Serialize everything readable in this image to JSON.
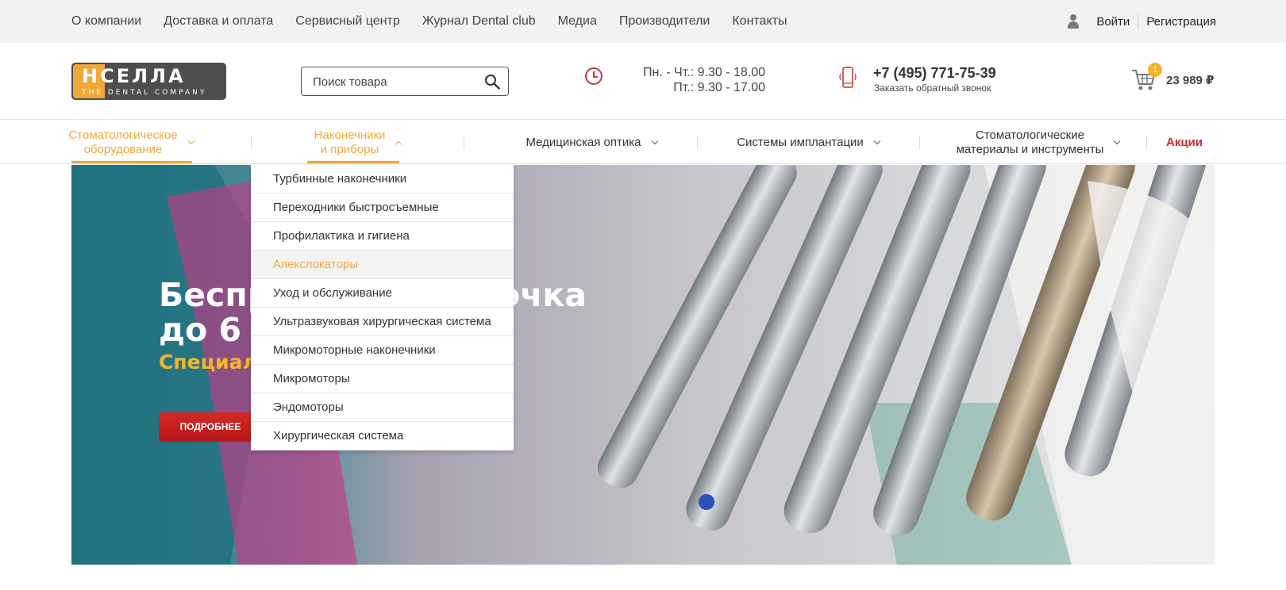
{
  "topnav": {
    "links": [
      "О компании",
      "Доставка и оплата",
      "Сервисный центр",
      "Журнал Dental club",
      "Медиа",
      "Производители",
      "Контакты"
    ]
  },
  "auth": {
    "login": "Войти",
    "register": "Регистрация",
    "user_icon": "user-icon"
  },
  "logo": {
    "big": "НСЕЛЛА",
    "small": "THE DENTAL COMPANY"
  },
  "search": {
    "placeholder": "Поиск товара",
    "icon": "search-icon"
  },
  "hours": {
    "line1": "Пн. - Чт.: 9.30 - 18.00",
    "line2": "Пт.: 9.30 - 17.00",
    "icon": "clock-icon"
  },
  "phone": {
    "number": "+7 (495) 771-75-39",
    "callback": "Заказать обратный звонок",
    "icon": "mobile-phone-icon"
  },
  "cart": {
    "count": "1",
    "total": "23 989 ₽",
    "icon": "cart-icon"
  },
  "categories": [
    "Стоматологическое оборудование",
    "Наконечники и приборы",
    "Медицинская оптика",
    "Системы имплантации",
    "Стоматологические материалы  и инструменты",
    "Акции"
  ],
  "categories_l1": [
    "Стоматологическое",
    "Наконечники",
    "Стоматологические"
  ],
  "categories_l2": [
    "оборудование",
    "и приборы",
    "материалы  и инструменты"
  ],
  "banner": {
    "line1": "Беспр",
    "line1_tail": "очка",
    "line2": "до 6 м",
    "subtitle": "Специал",
    "button": "ПОДРОБНЕЕ"
  },
  "dropdown": {
    "items": [
      "Турбинные наконечники",
      "Переходники быстросъемные",
      "Профилактика и гигиена",
      "Апекслокаторы",
      "Уход и обслуживание",
      "Ультразвуковая хирургическая система",
      "Микромоторные наконечники",
      "Микромоторы",
      "Эндомоторы",
      "Хирургическая система"
    ],
    "highlighted": "Апекслокаторы"
  },
  "colors": {
    "accent": "#f0a83a",
    "red": "#d32a2a",
    "topbar": "#f2f2f2"
  }
}
